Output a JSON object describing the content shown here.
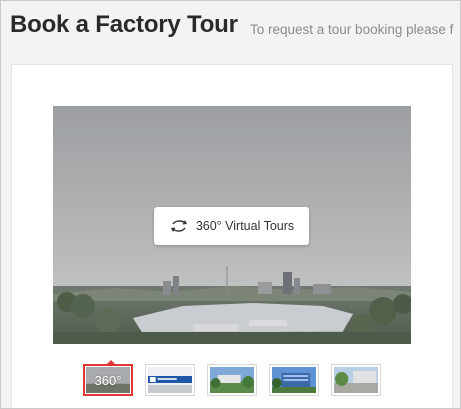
{
  "header": {
    "title": "Book a Factory Tour",
    "subtitle": "To request a tour booking please f"
  },
  "tour": {
    "button_label": "360° Virtual Tours",
    "icon": "rotate-360-icon"
  },
  "thumbnails": [
    {
      "label": "360°",
      "active": true
    },
    {
      "label": "",
      "active": false
    },
    {
      "label": "",
      "active": false
    },
    {
      "label": "",
      "active": false
    },
    {
      "label": "",
      "active": false
    }
  ],
  "colors": {
    "accent": "#e0373b",
    "title": "#2a2a2a",
    "subtitle": "#8b8b8b",
    "background": "#f3f3f5"
  }
}
